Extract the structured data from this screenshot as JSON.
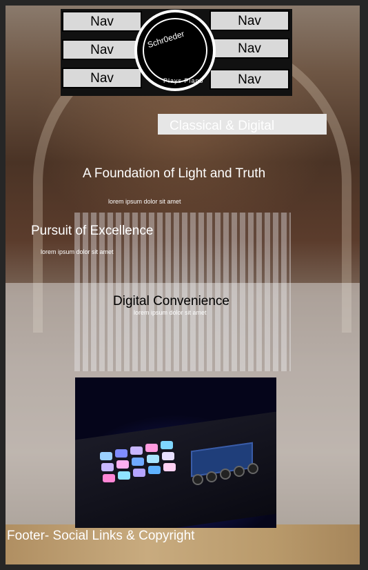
{
  "header": {
    "nav_left": [
      "Nav",
      "Nav",
      "Nav"
    ],
    "nav_right": [
      "Nav",
      "Nav",
      "Nav"
    ],
    "logo_top": "Schr0eder",
    "logo_bottom": "Plays Piano"
  },
  "hero": {
    "tagline": "Classical & Digital",
    "section1_title": "A Foundation of Light and Truth",
    "section1_text": "lorem ipsum dolor sit amet",
    "section2_title": "Pursuit of Excellence",
    "section2_text": "lorem ipsum dolor sit amet"
  },
  "digital": {
    "title": "Digital Convenience",
    "text": "lorem ipsum dolor sit amet"
  },
  "footer": {
    "text": "Footer- Social Links & Copyright"
  },
  "colors": {
    "nav_button": "#d9d9d9",
    "nav_bar": "#111111",
    "tagline_bg": "#e6e6e6",
    "footer_band": "#c8ab7f"
  }
}
